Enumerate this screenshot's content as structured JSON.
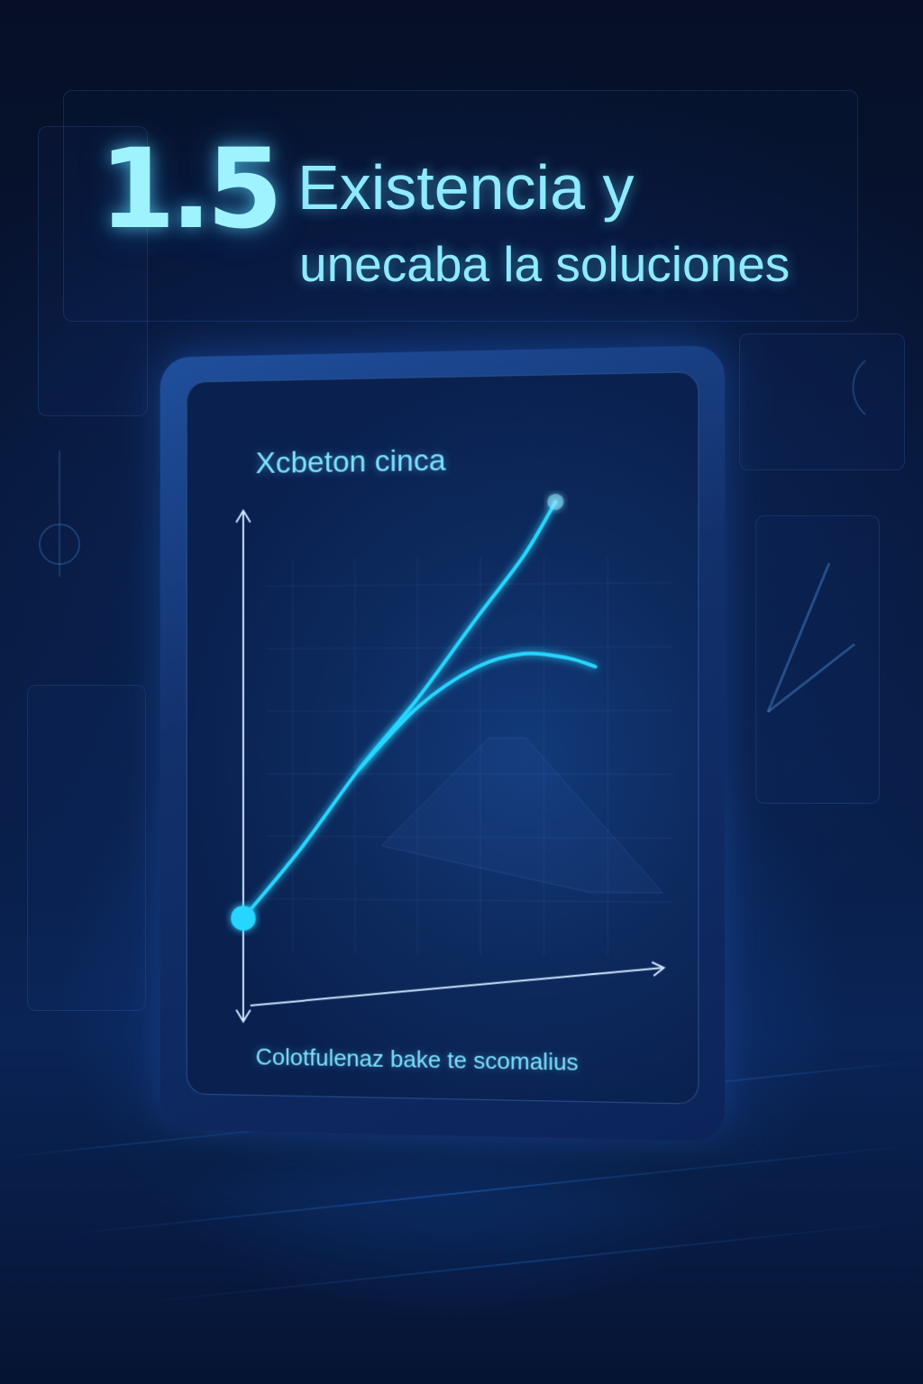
{
  "heading": {
    "number": "1.5",
    "line1": "Existencia y",
    "line2": "unecaba  la soluciones"
  },
  "card": {
    "title": "Xcbeton cinca",
    "caption": "Colotfulenaz bake te scomalius"
  },
  "colors": {
    "background": "#06122e",
    "accent": "#25d6ff",
    "text": "#8feaff",
    "device": "#12306b"
  },
  "chart_data": {
    "type": "line",
    "title": "Xcbeton cinca",
    "xlabel": "",
    "ylabel": "",
    "xlim": [
      0,
      10
    ],
    "ylim": [
      0,
      10
    ],
    "grid": false,
    "series": [
      {
        "points": [
          [
            0,
            0.2
          ],
          [
            1.5,
            1.8
          ],
          [
            3,
            3.6
          ],
          [
            4.5,
            5.2
          ],
          [
            6,
            7.0
          ],
          [
            7.2,
            8.4
          ],
          [
            8,
            9.6
          ]
        ]
      },
      {
        "points": [
          [
            3,
            3.6
          ],
          [
            4.5,
            5.0
          ],
          [
            6,
            5.9
          ],
          [
            7.2,
            6.2
          ],
          [
            8.3,
            6.1
          ],
          [
            9,
            5.9
          ]
        ]
      }
    ],
    "marker": {
      "x": 0,
      "y": 0.2
    }
  }
}
